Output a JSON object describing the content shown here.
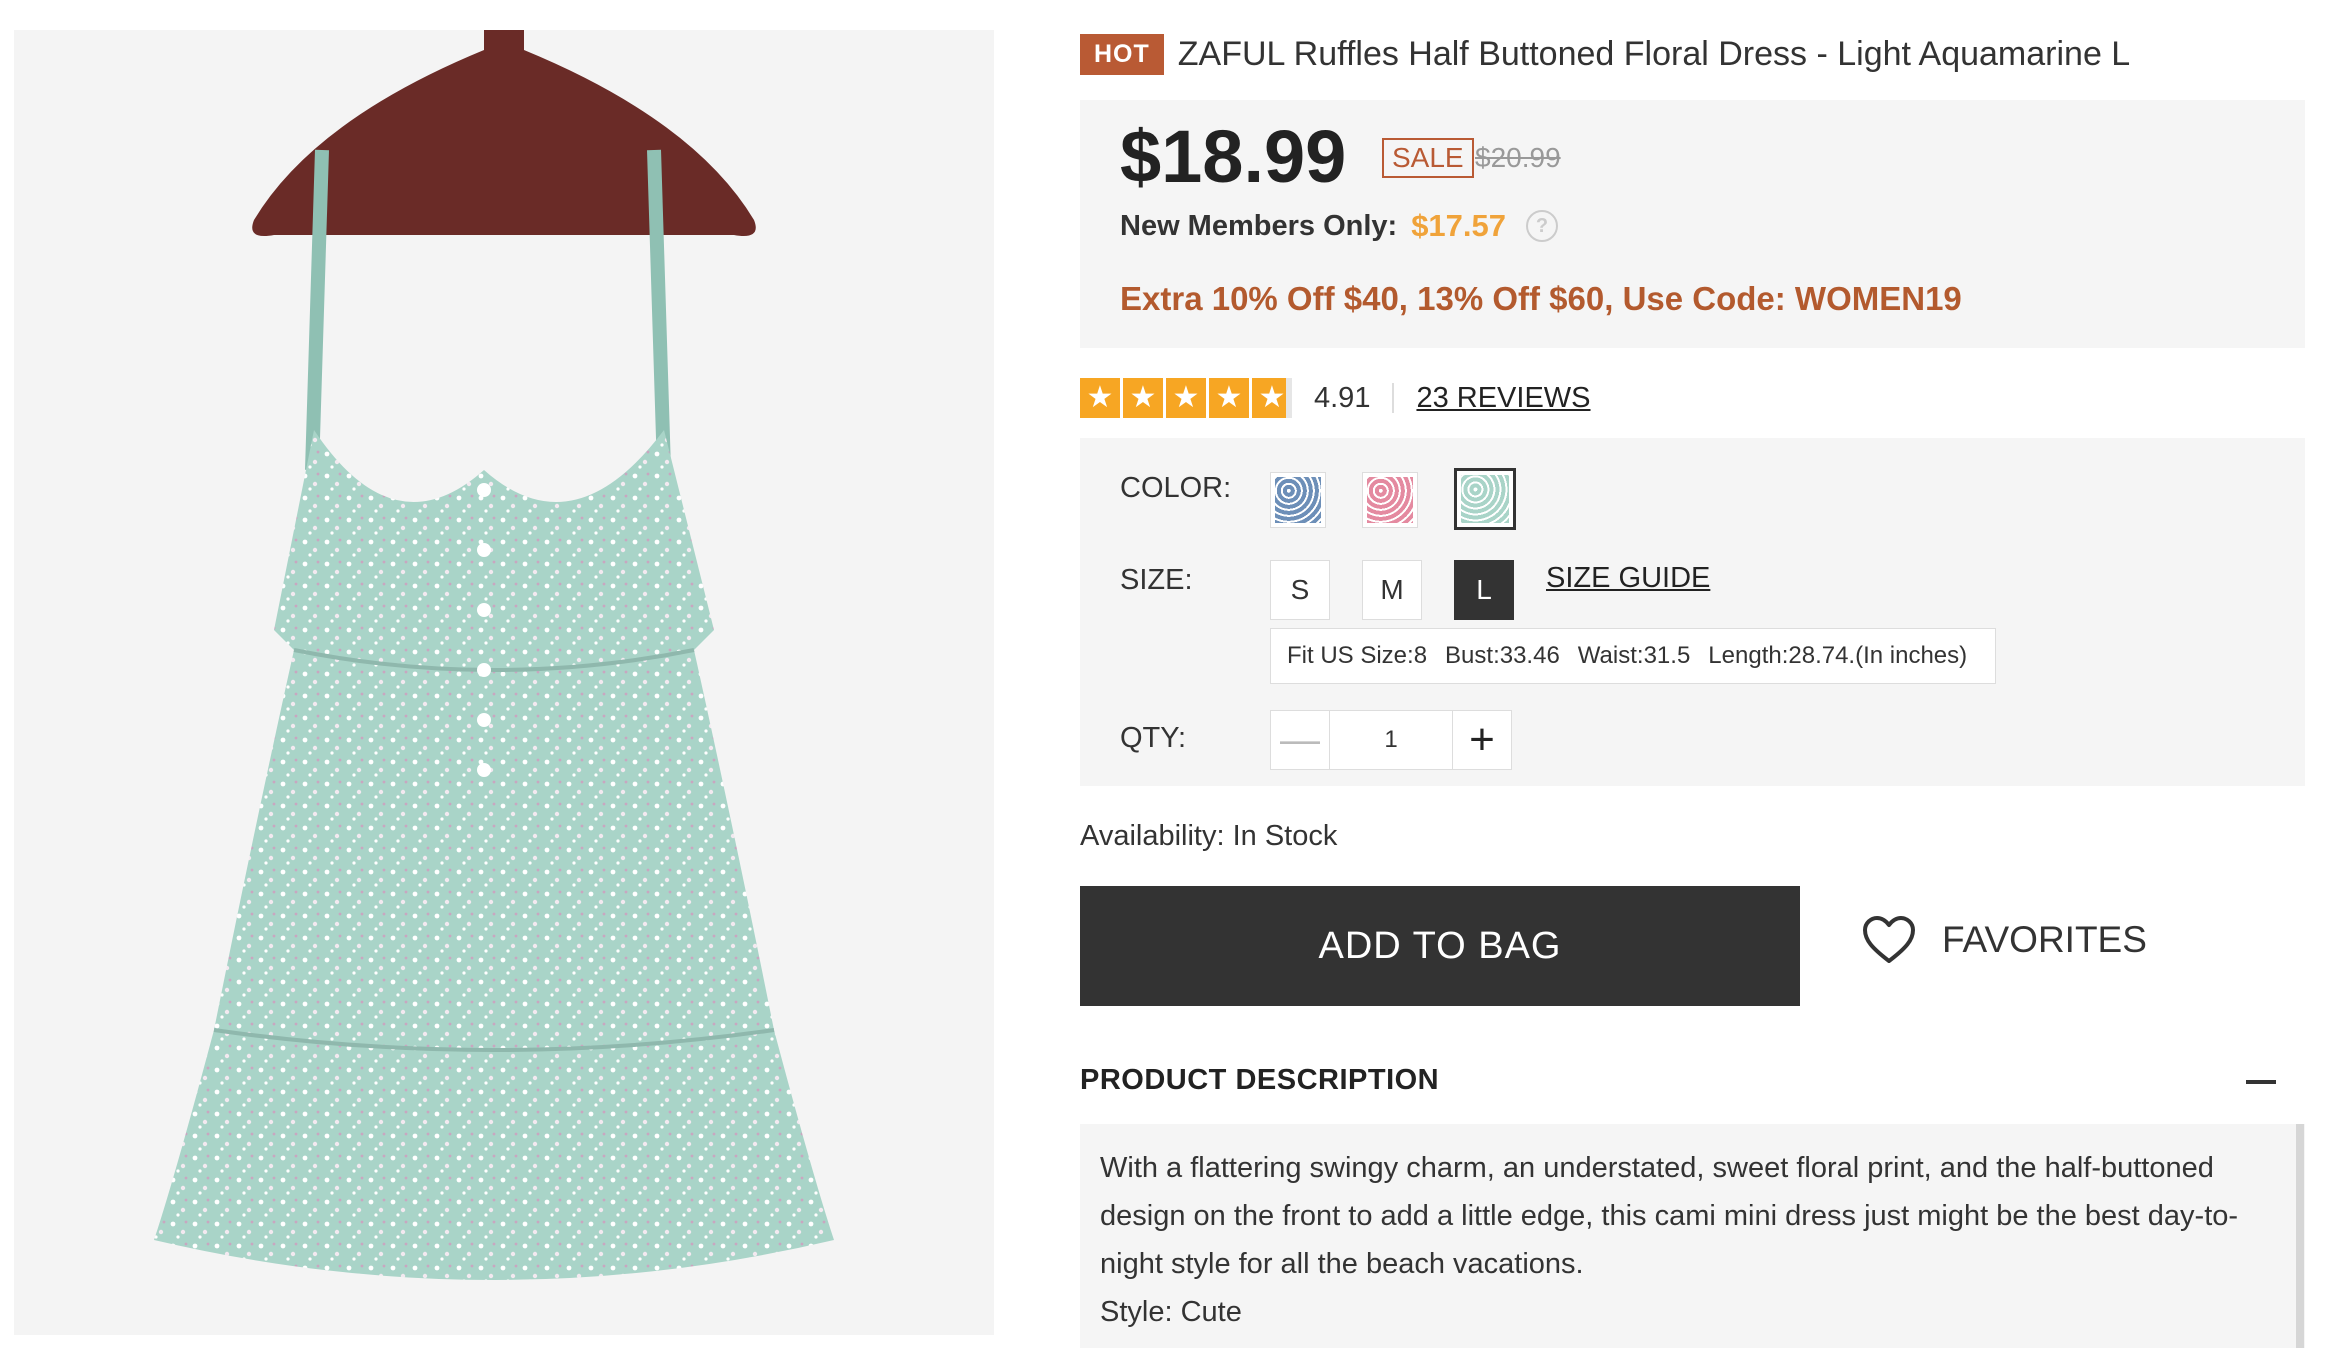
{
  "product": {
    "hot_badge": "HOT",
    "title": "ZAFUL Ruffles Half Buttoned Floral Dress - Light Aquamarine L",
    "price": "$18.99",
    "sale_badge": "SALE",
    "original_price": "$20.99",
    "members_label": "New Members Only:",
    "members_price": "$17.57",
    "promo": "Extra 10% Off $40, 13% Off $60, Use Code: WOMEN19"
  },
  "rating": {
    "stars": 5,
    "value": "4.91",
    "reviews_link": "23 REVIEWS"
  },
  "options": {
    "color_label": "COLOR:",
    "colors": [
      {
        "name": "blue-floral",
        "hex": "#6d8fb8"
      },
      {
        "name": "pink-floral",
        "hex": "#e48aa0"
      },
      {
        "name": "light-aquamarine-floral",
        "hex": "#a9d4c8",
        "selected": true
      }
    ],
    "size_label": "SIZE:",
    "sizes": [
      "S",
      "M",
      "L"
    ],
    "selected_size": "L",
    "size_guide": "SIZE GUIDE",
    "fit_info": {
      "fit": "Fit US Size:8",
      "bust": "Bust:33.46",
      "waist": "Waist:31.5",
      "length": "Length:28.74.(In inches)"
    },
    "qty_label": "QTY:",
    "qty_minus": "—",
    "qty_value": "1",
    "qty_plus": "+"
  },
  "availability": "Availability: In Stock",
  "actions": {
    "add_to_bag": "ADD TO BAG",
    "favorites": "FAVORITES"
  },
  "description": {
    "header": "PRODUCT DESCRIPTION",
    "text": "With a flattering swingy charm, an understated, sweet floral print, and the half-buttoned design on the front to add a little edge, this cami mini dress just might be the best day-to-night style for all the beach vacations.",
    "style": "Style: Cute"
  },
  "colors": {
    "accent": "#b95a34",
    "member_price": "#f0a33a",
    "star": "#f7a623",
    "dark_button": "#333333",
    "panel_bg": "#f5f5f5"
  }
}
